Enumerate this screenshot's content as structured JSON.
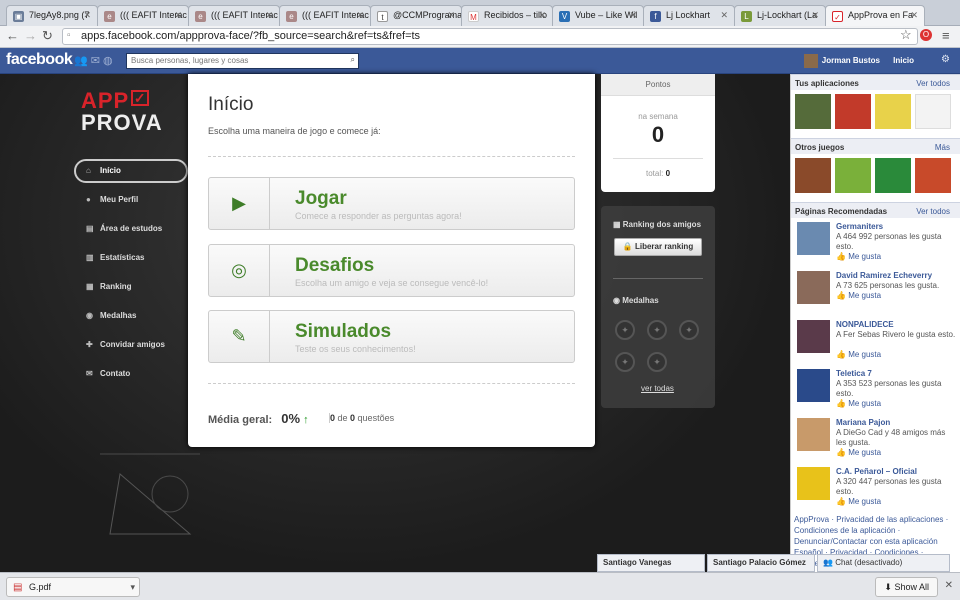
{
  "browser": {
    "tabs": [
      {
        "title": "7legAy8.png (7",
        "icon": "image-icon"
      },
      {
        "title": "((( EAFIT Interac",
        "icon": "eafit-icon"
      },
      {
        "title": "((( EAFIT Interac",
        "icon": "eafit-icon"
      },
      {
        "title": "((( EAFIT Interac",
        "icon": "eafit-icon"
      },
      {
        "title": "@CCMProgramac",
        "icon": "twitter-icon"
      },
      {
        "title": "Recibidos – tillo",
        "icon": "gmail-icon"
      },
      {
        "title": "Vube – Like Wil",
        "icon": "vube-icon"
      },
      {
        "title": "Lj Lockhart",
        "icon": "facebook-icon"
      },
      {
        "title": "Lj-Lockhart (La",
        "icon": "page-icon"
      },
      {
        "title": "AppProva en Fa",
        "icon": "appprova-icon"
      }
    ],
    "url": "apps.facebook.com/appprova-face/?fb_source=search&ref=ts&fref=ts"
  },
  "facebook": {
    "logo": "facebook",
    "search_placeholder": "Busca personas, lugares y cosas",
    "user": "Jorman Bustos",
    "home": "Inicio"
  },
  "app": {
    "logo_top": "APP",
    "logo_bottom": "PROVA",
    "menu": [
      {
        "label": "Início",
        "icon": "home-icon",
        "glyph": "⌂"
      },
      {
        "label": "Meu Perfil",
        "icon": "user-icon",
        "glyph": "●"
      },
      {
        "label": "Área de estudos",
        "icon": "book-icon",
        "glyph": "▤"
      },
      {
        "label": "Estatísticas",
        "icon": "stats-icon",
        "glyph": "▥"
      },
      {
        "label": "Ranking",
        "icon": "ranking-icon",
        "glyph": "▦"
      },
      {
        "label": "Medalhas",
        "icon": "medal-icon",
        "glyph": "◉"
      },
      {
        "label": "Convidar amigos",
        "icon": "invite-icon",
        "glyph": "✚"
      },
      {
        "label": "Contato",
        "icon": "contact-icon",
        "glyph": "✉"
      }
    ],
    "title": "Início",
    "subtitle": "Escolha uma maneira de jogo e comece já:",
    "options": [
      {
        "title": "Jogar",
        "desc": "Comece a responder as perguntas agora!",
        "icon": "play-icon",
        "glyph": "▶"
      },
      {
        "title": "Desafios",
        "desc": "Escolha um amigo e veja se consegue vencê-lo!",
        "icon": "gamepad-icon",
        "glyph": "◎"
      },
      {
        "title": "Simulados",
        "desc": "Teste os seus conhecimentos!",
        "icon": "clipboard-icon",
        "glyph": "✎"
      }
    ],
    "media_label": "Média geral:",
    "media_value": "0%",
    "questions_done": "0",
    "questions_mid": " de ",
    "questions_total": "0",
    "questions_label": " questões",
    "points": {
      "header": "Pontos",
      "week_label": "na semana",
      "week_value": "0",
      "total_label": "total: ",
      "total_value": "0"
    },
    "ranking_header": "Ranking dos amigos",
    "ranking_button": "Liberar ranking",
    "medals_header": "Medalhas",
    "see_all": "ver todas"
  },
  "sidebar": {
    "apps_header": "Tus aplicaciones",
    "see_all": "Ver todos",
    "games_header": "Otros juegos",
    "more": "Más",
    "pages_header": "Páginas Recomendadas",
    "like": "Me gusta",
    "pages": [
      {
        "name": "Germaniters",
        "desc": "A 464 992 personas les gusta esto."
      },
      {
        "name": "David Ramirez Echeverry",
        "desc": "A 73 625 personas les gusta."
      },
      {
        "name": "NONPALIDECE",
        "desc": "A Fer Sebas Rivero le gusta esto."
      },
      {
        "name": "Teletica 7",
        "desc": "A 353 523 personas les gusta esto."
      },
      {
        "name": "Mariana Pajon",
        "desc": "A DieGo Cad y 48 amigos más les gusta."
      },
      {
        "name": "C.A. Peñarol – Oficial",
        "desc": "A 320 447 personas les gusta esto."
      }
    ],
    "footer": "AppProva · Privacidad de las aplicaciones · Condiciones de la aplicación · Denunciar/Contactar con esta aplicación",
    "footer2": "Español · Privacidad · Condiciones · Cookies"
  },
  "chat": {
    "friend1": "Santiago Vanegas",
    "friend2": "Santiago Palacio Gómez",
    "status": "Chat (desactivado)"
  },
  "downloads": {
    "file": "G.pdf",
    "show_all": "Show All"
  }
}
